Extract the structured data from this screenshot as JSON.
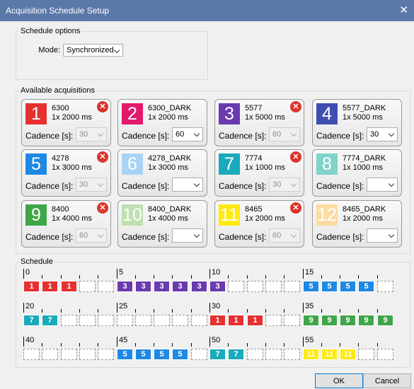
{
  "window": {
    "title": "Acquisition Schedule Setup",
    "close_glyph": "✕"
  },
  "schedule_options": {
    "legend": "Schedule options",
    "mode_label": "Mode:",
    "mode_value": "Synchronized"
  },
  "acquisitions": {
    "legend": "Available acquisitions",
    "cadence_label": "Cadence [s]:",
    "remove_glyph": "✕",
    "items": [
      {
        "num": "1",
        "color": "#e5312f",
        "name": "6300",
        "exposure": "1x 2000 ms",
        "cadence": "30",
        "cadence_enabled": false,
        "removable": true,
        "light": false
      },
      {
        "num": "2",
        "color": "#e4196d",
        "name": "6300_DARK",
        "exposure": "1x 2000 ms",
        "cadence": "60",
        "cadence_enabled": true,
        "removable": false,
        "light": false
      },
      {
        "num": "3",
        "color": "#6a3aaf",
        "name": "5577",
        "exposure": "1x 5000 ms",
        "cadence": "60",
        "cadence_enabled": false,
        "removable": true,
        "light": false
      },
      {
        "num": "4",
        "color": "#3f4fb0",
        "name": "5577_DARK",
        "exposure": "1x 5000 ms",
        "cadence": "30",
        "cadence_enabled": true,
        "removable": false,
        "light": false
      },
      {
        "num": "5",
        "color": "#1e88e5",
        "name": "4278",
        "exposure": "1x 3000 ms",
        "cadence": "30",
        "cadence_enabled": false,
        "removable": true,
        "light": false
      },
      {
        "num": "6",
        "color": "#a8d3f5",
        "name": "4278_DARK",
        "exposure": "1x 3000 ms",
        "cadence": "",
        "cadence_enabled": true,
        "removable": false,
        "light": true
      },
      {
        "num": "7",
        "color": "#19aabb",
        "name": "7774",
        "exposure": "1x 1000 ms",
        "cadence": "30",
        "cadence_enabled": false,
        "removable": true,
        "light": false
      },
      {
        "num": "8",
        "color": "#7fd3c8",
        "name": "7774_DARK",
        "exposure": "1x 1000 ms",
        "cadence": "",
        "cadence_enabled": true,
        "removable": false,
        "light": true
      },
      {
        "num": "9",
        "color": "#3fa648",
        "name": "8400",
        "exposure": "1x 4000 ms",
        "cadence": "60",
        "cadence_enabled": false,
        "removable": true,
        "light": false
      },
      {
        "num": "10",
        "color": "#bfe0b0",
        "name": "8400_DARK",
        "exposure": "1x 4000 ms",
        "cadence": "",
        "cadence_enabled": true,
        "removable": false,
        "light": true
      },
      {
        "num": "11",
        "color": "#ffe912",
        "name": "8465",
        "exposure": "1x 2000 ms",
        "cadence": "60",
        "cadence_enabled": false,
        "removable": true,
        "light": false
      },
      {
        "num": "12",
        "color": "#fddba2",
        "name": "8465_DARK",
        "exposure": "1x 2000 ms",
        "cadence": "",
        "cadence_enabled": true,
        "removable": false,
        "light": true
      }
    ]
  },
  "schedule": {
    "legend": "Schedule",
    "rows": [
      {
        "start": 0,
        "slots": [
          "1",
          "1",
          "1",
          "",
          "",
          "3",
          "3",
          "3",
          "3",
          "3",
          "3",
          "",
          "",
          "",
          "",
          "5",
          "5",
          "5",
          "5",
          ""
        ]
      },
      {
        "start": 20,
        "slots": [
          "7",
          "7",
          "",
          "",
          "",
          "",
          "",
          "",
          "",
          "",
          "1",
          "1",
          "1",
          "",
          "",
          "9",
          "9",
          "9",
          "9",
          "9"
        ]
      },
      {
        "start": 40,
        "slots": [
          "",
          "",
          "",
          "",
          "",
          "5",
          "5",
          "5",
          "5",
          "",
          "7",
          "7",
          "",
          "",
          "",
          "11",
          "11",
          "11",
          "",
          ""
        ]
      }
    ]
  },
  "buttons": {
    "ok": "OK",
    "cancel": "Cancel"
  }
}
